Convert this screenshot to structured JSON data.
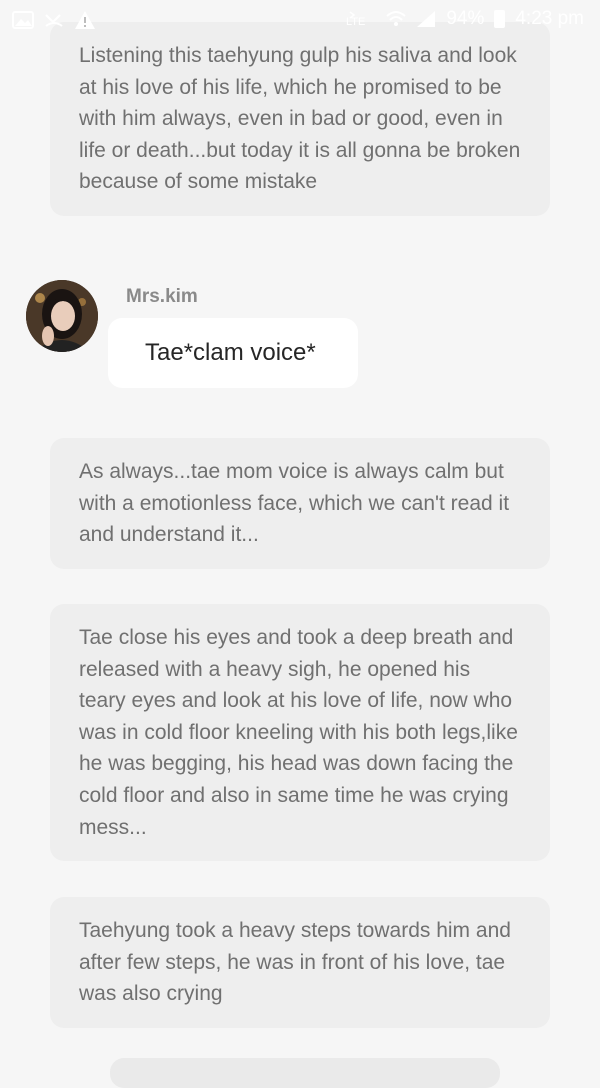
{
  "status_bar": {
    "battery_percent": "94%",
    "time": "4:23 pm",
    "lte_label": "LTE",
    "left_icons": [
      "image-icon",
      "missed-call-icon",
      "warning-icon"
    ],
    "right_icons": [
      "volte-icon",
      "wifi-icon",
      "signal-icon",
      "battery-icon"
    ]
  },
  "story": {
    "blocks": [
      {
        "type": "narration",
        "text": "Listening this taehyung gulp his saliva and look at his love of his life, which he promised to be with him always, even in bad or good, even in life or death...but today it is all gonna be broken because of some mistake"
      },
      {
        "type": "message",
        "sender": "Mrs.kim",
        "text": "Tae*clam voice*"
      },
      {
        "type": "narration",
        "text": "As always...tae mom voice is always calm but with a emotionless face, which we can't read it and understand it..."
      },
      {
        "type": "narration",
        "text": "Tae close his eyes and took a deep breath and released with a heavy sigh, he opened his teary eyes and look at his love of life, now who was in cold floor kneeling with his both legs,like he was begging, his head was down facing the cold floor and also in same time he was crying mess..."
      },
      {
        "type": "narration",
        "text": "Taehyung took a heavy steps towards him and after few steps, he was in front of his love, tae was also crying"
      }
    ]
  }
}
